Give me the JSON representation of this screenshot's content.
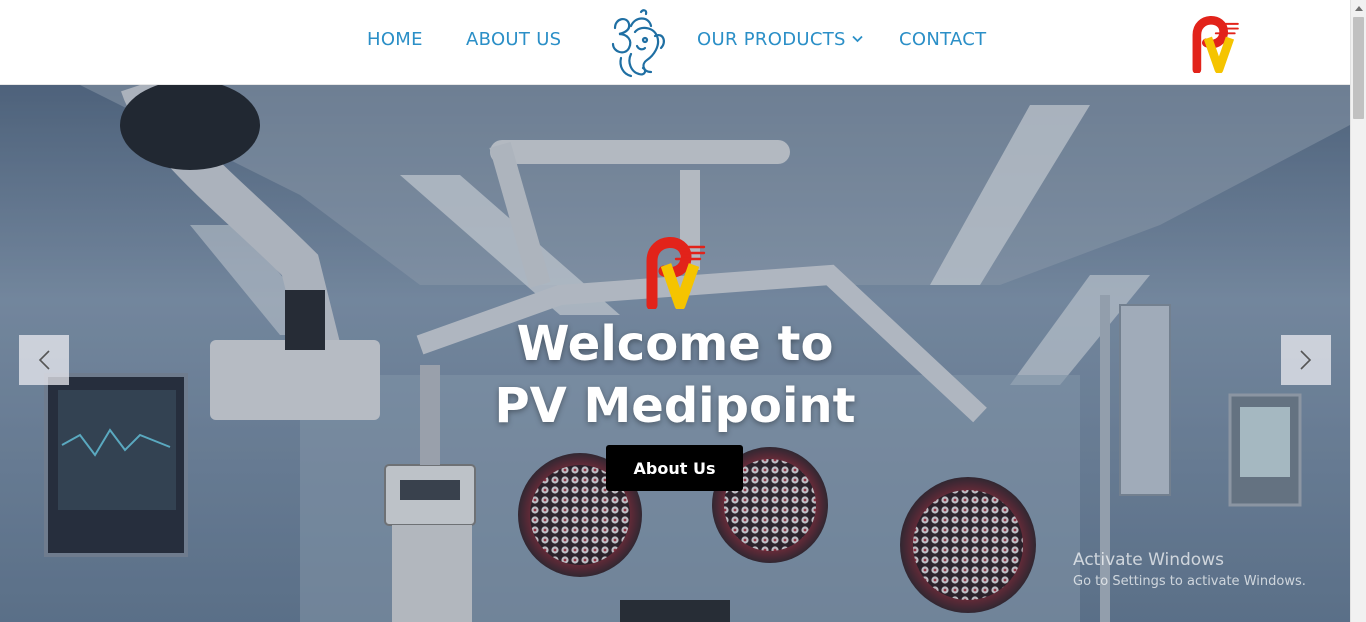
{
  "nav": {
    "home": "HOME",
    "about": "ABOUT US",
    "products": "OUR PRODUCTS",
    "contact": "CONTACT"
  },
  "brand": {
    "header_emblem_icon": "ganesha-om-icon",
    "logo_icon": "pv-logo-icon",
    "logo_letters": "PV"
  },
  "hero": {
    "title_line1": "Welcome to",
    "title_line2": "PV Medipoint",
    "button_label": "About Us",
    "background": "operating-room-image",
    "prev_icon": "chevron-left-icon",
    "next_icon": "chevron-right-icon"
  },
  "watermark": {
    "title": "Activate Windows",
    "subtitle": "Go to Settings to activate Windows."
  },
  "colors": {
    "nav_text": "#2b8fc7",
    "logo_red": "#e2231a",
    "logo_yellow": "#f5c400",
    "button_bg": "#000000"
  }
}
